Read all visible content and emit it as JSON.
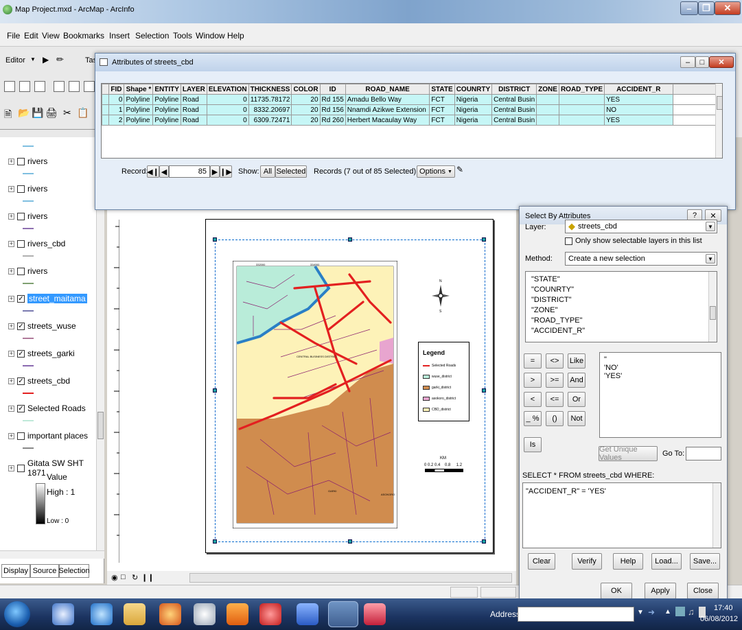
{
  "window": {
    "title": "Map Project.mxd - ArcMap - ArcInfo"
  },
  "menu": [
    "File",
    "Edit",
    "View",
    "Bookmarks",
    "Insert",
    "Selection",
    "Tools",
    "Window",
    "Help"
  ],
  "toolbar": {
    "editor_label": "Editor",
    "task_label": "Task"
  },
  "toc": {
    "layers": [
      {
        "name": "rivers",
        "checked": false,
        "color": "#7fbfe0"
      },
      {
        "name": "rivers",
        "checked": false,
        "color": "#7fbfe0"
      },
      {
        "name": "rivers",
        "checked": false,
        "color": "#7fbfe0"
      },
      {
        "name": "rivers_cbd",
        "checked": false,
        "color": "#8e6fb0"
      },
      {
        "name": "rivers",
        "checked": false,
        "color": "#b0b0b0"
      },
      {
        "name": "street_maitama",
        "checked": true,
        "color": "#7fa070"
      },
      {
        "name": "streets_wuse",
        "checked": true,
        "color": "#7a7ab0"
      },
      {
        "name": "streets_garki",
        "checked": true,
        "color": "#b07a9a"
      },
      {
        "name": "streets_cbd",
        "checked": true,
        "color": "#8a6ab0"
      },
      {
        "name": "Selected Roads",
        "checked": true,
        "color": "#e32020"
      },
      {
        "name": "important places",
        "checked": false,
        "color": "#bfe9d9"
      },
      {
        "name": "Gitata SW SHT 1871",
        "checked": false,
        "color": "#888888"
      }
    ],
    "raster_value_label": "Value",
    "raster_high": "High : 1",
    "raster_low": "Low : 0",
    "tabs": [
      "Display",
      "Source",
      "Selection"
    ]
  },
  "attribute_table": {
    "title": "Attributes of streets_cbd",
    "columns": [
      "",
      "FID",
      "Shape *",
      "ENTITY",
      "LAYER",
      "ELEVATION",
      "THICKNESS",
      "COLOR",
      "ID",
      "ROAD_NAME",
      "STATE",
      "COUNRTY",
      "DISTRICT",
      "ZONE",
      "ROAD_TYPE",
      "ACCIDENT_R"
    ],
    "rows": [
      [
        "",
        "0",
        "Polyline",
        "Polyline",
        "Road",
        "0",
        "11735.78172",
        "20",
        "Rd 155",
        "Amadu Bello Way",
        "FCT",
        "Nigeria",
        "Central Busin",
        "",
        "",
        "YES"
      ],
      [
        "",
        "1",
        "Polyline",
        "Polyline",
        "Road",
        "0",
        "8332.20697",
        "20",
        "Rd 156",
        "Nnamdi Azikwe Extension",
        "FCT",
        "Nigeria",
        "Central Busin",
        "",
        "",
        "NO"
      ],
      [
        "",
        "2",
        "Polyline",
        "Polyline",
        "Road",
        "0",
        "6309.72471",
        "20",
        "Rd 260",
        "Herbert Macaulay Way",
        "FCT",
        "Nigeria",
        "Central Busin",
        "",
        "",
        "YES"
      ]
    ],
    "record_label": "Record:",
    "record_value": "85",
    "show_label": "Show:",
    "show_all": "All",
    "show_selected": "Selected",
    "records_text": "Records (7 out of 85 Selected)",
    "options_label": "Options"
  },
  "map": {
    "legend_title": "Legend",
    "legend_items": [
      {
        "label": "Selected Roads",
        "kind": "line",
        "color": "#e32020"
      },
      {
        "label": "wuse_district",
        "kind": "fill",
        "color": "#b9ecd9"
      },
      {
        "label": "garki_district",
        "kind": "fill",
        "color": "#d08c4e"
      },
      {
        "label": "asokoro_district",
        "kind": "fill",
        "color": "#e8a5cf"
      },
      {
        "label": "CBD_district",
        "kind": "fill",
        "color": "#fdf2b8"
      }
    ],
    "scale_unit": "KM",
    "scale_ticks": "0 0.2 0.4    0.8     1.2",
    "north_n": "N",
    "north_s": "S",
    "label_cbd": "CENTRAL BUSINESS DISTRICT",
    "label_garki": "GARKI",
    "label_asokoro": "ASOKORO",
    "grid_top_1": "332000",
    "grid_top_2": "334000"
  },
  "select_by_attributes": {
    "title": "Select By Attributes",
    "layer_label": "Layer:",
    "layer_value": "streets_cbd",
    "only_selectable": "Only show selectable layers in this list",
    "method_label": "Method:",
    "method_value": "Create a new selection",
    "fields": [
      "\"STATE\"",
      "\"COUNRTY\"",
      "\"DISTRICT\"",
      "\"ZONE\"",
      "\"ROAD_TYPE\"",
      "\"ACCIDENT_R\""
    ],
    "operators": [
      "=",
      "<>",
      "Like",
      ">",
      ">=",
      "And",
      "<",
      "<=",
      "Or",
      "_ %",
      "()",
      "Not",
      "Is"
    ],
    "values": [
      "\"",
      "'NO'",
      "'YES'"
    ],
    "get_unique_values": "Get Unique Values",
    "go_to": "Go To:",
    "sql_prefix": "SELECT * FROM streets_cbd WHERE:",
    "expression": "\"ACCIDENT_R\" = 'YES'",
    "buttons": [
      "Clear",
      "Verify",
      "Help",
      "Load...",
      "Save..."
    ],
    "ok": "OK",
    "apply": "Apply",
    "close": "Close"
  },
  "taskbar": {
    "address_label": "Address",
    "time": "17:40",
    "date": "06/08/2012"
  },
  "colors": {
    "selected_row": "#c6f6f6",
    "selected_roads": "#e32020",
    "garki": "#d08c4e",
    "cbd": "#fdf2b8",
    "wuse": "#b9ecd9"
  }
}
